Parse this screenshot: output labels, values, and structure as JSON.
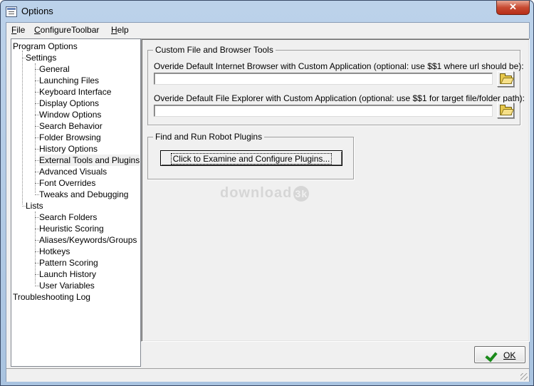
{
  "window": {
    "title": "Options",
    "close_label": "✕"
  },
  "menu": [
    {
      "accel": "F",
      "rest": "ile"
    },
    {
      "accel": "C",
      "rest": "onfigureToolbar"
    },
    {
      "accel": "H",
      "rest": "elp"
    }
  ],
  "tree": {
    "root": "Program Options",
    "settings": "Settings",
    "settings_items": [
      "General",
      "Launching Files",
      "Keyboard Interface",
      "Display Options",
      "Window Options",
      "Search Behavior",
      "Folder Browsing",
      "History Options",
      "External Tools and Plugins",
      "Advanced Visuals",
      "Font Overrides",
      "Tweaks and Debugging"
    ],
    "lists": "Lists",
    "lists_items": [
      "Search Folders",
      "Heuristic Scoring",
      "Aliases/Keywords/Groups",
      "Hotkeys",
      "Pattern Scoring",
      "Launch History",
      "User Variables"
    ],
    "troubleshooting": "Troubleshooting Log",
    "selected": "External Tools and Plugins"
  },
  "custom_tools": {
    "group_title": "Custom File and Browser Tools",
    "browser_label": "Overide Default Internet Browser with Custom Application (optional: use $$1 where url should be):",
    "browser_value": "",
    "explorer_label": "Overide Default File Explorer with Custom Application (optional: use $$1 for target file/folder path):",
    "explorer_value": ""
  },
  "plugins": {
    "group_title": "Find and Run Robot Plugins",
    "button_label": "Click to Examine and Configure Plugins..."
  },
  "watermark": {
    "text": "download",
    "badge": "3k"
  },
  "ok_button": {
    "label": "OK"
  }
}
